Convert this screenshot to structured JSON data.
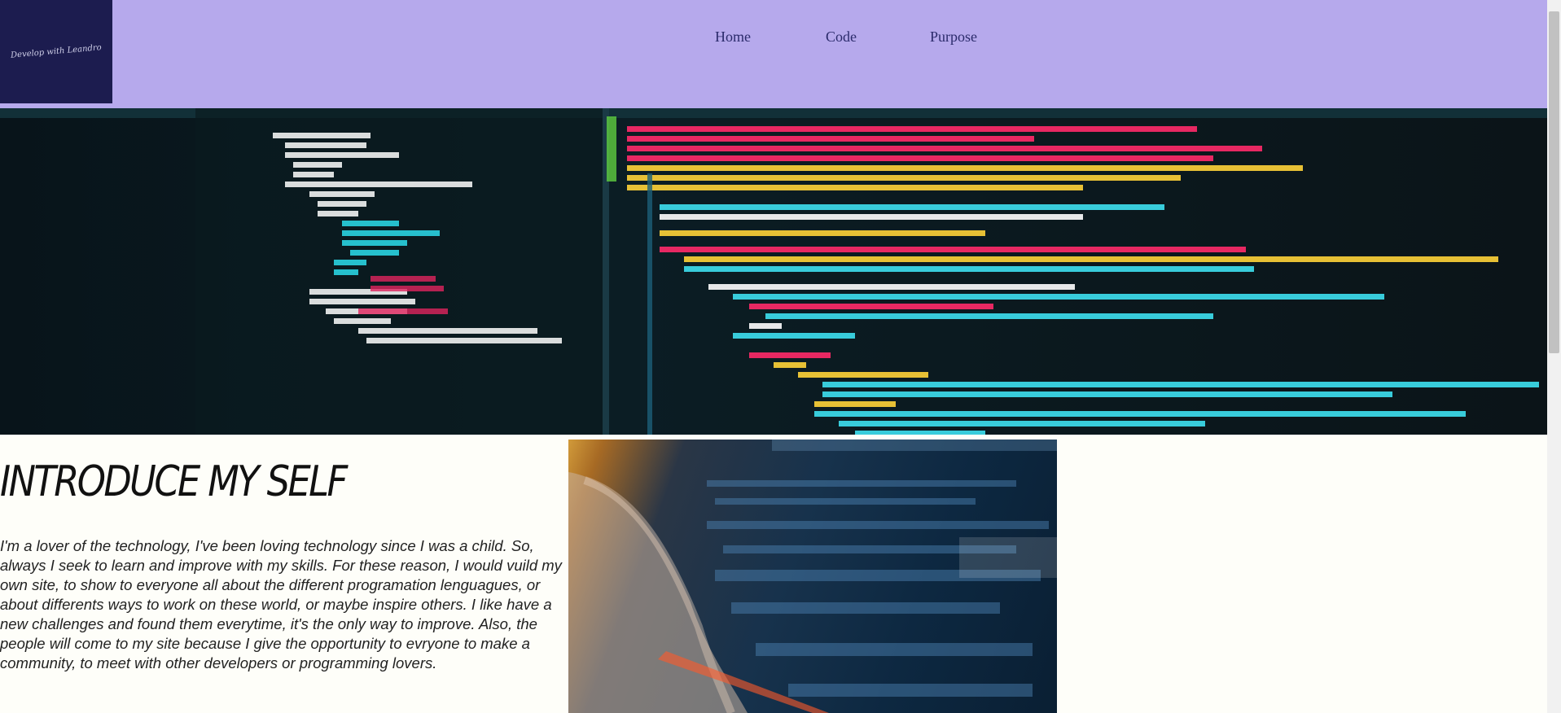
{
  "header": {
    "logo_text": "Develop with Leandro",
    "nav": [
      {
        "label": "Home"
      },
      {
        "label": "Code"
      },
      {
        "label": "Purpose"
      }
    ]
  },
  "intro": {
    "title": "INTRODUCE MY SELF",
    "body": "I'm a lover of the technology, I've been loving technology since I was a child. So, always I seek to learn and improve with my skills. For these reason, I would vuild my own site, to show to everyone all about the different programation lenguagues, or about differents ways to work on these world, or maybe inspire others. I like have a new challenges and found them everytime, it's the only way to improve. Also, the people will come to my site because I give the opportunity to evryone to make a community, to meet with other developers or programming lovers."
  },
  "colors": {
    "header_bg": "#b6a9ec",
    "logo_bg": "#1c1c4f",
    "nav_text": "#2b2b6b",
    "page_bg": "#fefef9"
  }
}
